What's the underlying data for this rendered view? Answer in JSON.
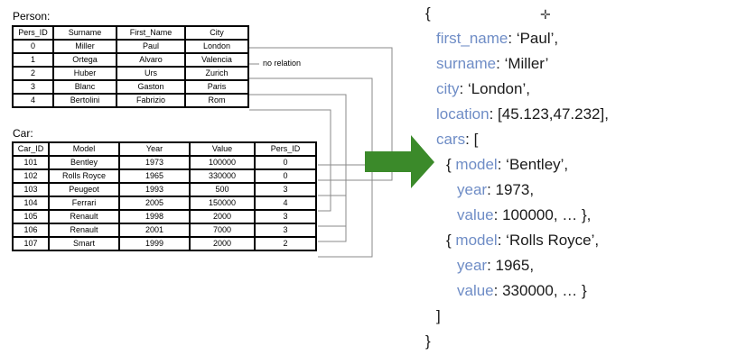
{
  "person": {
    "title": "Person:",
    "headers": [
      "Pers_ID",
      "Surname",
      "First_Name",
      "City"
    ],
    "rows": [
      [
        "0",
        "Miller",
        "Paul",
        "London"
      ],
      [
        "1",
        "Ortega",
        "Alvaro",
        "Valencia"
      ],
      [
        "2",
        "Huber",
        "Urs",
        "Zurich"
      ],
      [
        "3",
        "Blanc",
        "Gaston",
        "Paris"
      ],
      [
        "4",
        "Bertolini",
        "Fabrizio",
        "Rom"
      ]
    ],
    "no_relation": "no relation"
  },
  "car": {
    "title": "Car:",
    "headers": [
      "Car_ID",
      "Model",
      "Year",
      "Value",
      "Pers_ID"
    ],
    "rows": [
      [
        "101",
        "Bentley",
        "1973",
        "100000",
        "0"
      ],
      [
        "102",
        "Rolls Royce",
        "1965",
        "330000",
        "0"
      ],
      [
        "103",
        "Peugeot",
        "1993",
        "500",
        "3"
      ],
      [
        "104",
        "Ferrari",
        "2005",
        "150000",
        "4"
      ],
      [
        "105",
        "Renault",
        "1998",
        "2000",
        "3"
      ],
      [
        "106",
        "Renault",
        "2001",
        "7000",
        "3"
      ],
      [
        "107",
        "Smart",
        "1999",
        "2000",
        "2"
      ]
    ]
  },
  "arrow_color": "#3b8a2a",
  "json_doc": {
    "open_brace": "{",
    "first_name_key": "first_name",
    "first_name_val": ": ‘Paul’,",
    "surname_key": "surname",
    "surname_val": ": ‘Miller’",
    "city_key": "city",
    "city_val": ": ‘London’,",
    "location_key": "location",
    "location_val": ": [45.123,47.232],",
    "cars_key": "cars",
    "cars_val": ": [",
    "car1_open": "{ ",
    "car1_model_key": "model",
    "car1_model_val": ": ‘Bentley’,",
    "car1_year_key": "year",
    "car1_year_val": ": 1973,",
    "car1_value_key": "value",
    "car1_value_val": ": 100000, … },",
    "car2_open": "{ ",
    "car2_model_key": "model",
    "car2_model_val": ": ‘Rolls Royce’,",
    "car2_year_key": "year",
    "car2_year_val": ": 1965,",
    "car2_value_key": "value",
    "car2_value_val": ": 330000, … }",
    "close_bracket": "]",
    "close_brace": "}"
  }
}
